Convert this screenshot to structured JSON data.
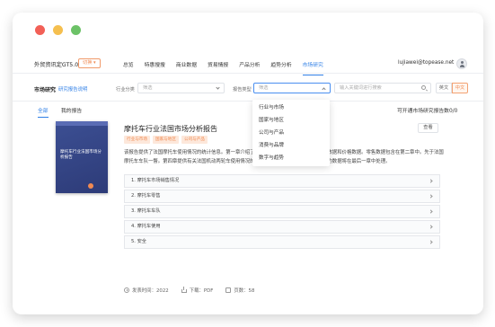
{
  "nav": {
    "logo": "外贸资讯定GT5.0",
    "switch_label": "切换",
    "items": [
      "总览",
      "特惠搜搜",
      "商业数据",
      "贸易情报",
      "产品分析",
      "趋势分析",
      "市场研究"
    ],
    "active_index": 6,
    "user_email": "lujiawei@topease.net"
  },
  "filter": {
    "section_title": "市场研究",
    "section_sub": "研究报告说明",
    "industry_label": "行业分类",
    "industry_placeholder": "筛选",
    "type_label": "报告类型",
    "type_placeholder": "筛选",
    "search_placeholder": "输入关键词进行搜索",
    "lang_en": "英文",
    "lang_zh": "中文"
  },
  "tabs": {
    "all": "全部",
    "mine": "我的报告",
    "count_text": "可开通市场研究报告数0/0"
  },
  "report": {
    "cover_title": "摩托车行业法国市场分析报告",
    "title": "摩托车行业法国市场分析报告",
    "view_label": "查看",
    "tags": [
      "行业与市场",
      "国家与地区",
      "公司与产品"
    ],
    "description": "该报告提供了法国摩托车使用情况的统计信息。第一章介绍了法国摩托车的相关信息，包括统计数据和价格数据。零售数据包含在第二章中。先于法国摩托车车队一瞥。第四章提供有关法国机动两轮车使用情况的数据。最后，有关法国涉及摩托车的数据将在最后一章中处理。",
    "chapters": [
      "1. 摩托车市场销售情况",
      "2. 摩托车零售",
      "3. 摩托车车队",
      "4. 摩托车使用",
      "5. 安全"
    ],
    "publish": "发表时间：2022",
    "download": "下载：PDF",
    "pages": "页数：58"
  },
  "dropdown": {
    "items": [
      "行业与市场",
      "国家与地区",
      "公司与产品",
      "消费与品牌",
      "数字与趋势"
    ]
  }
}
